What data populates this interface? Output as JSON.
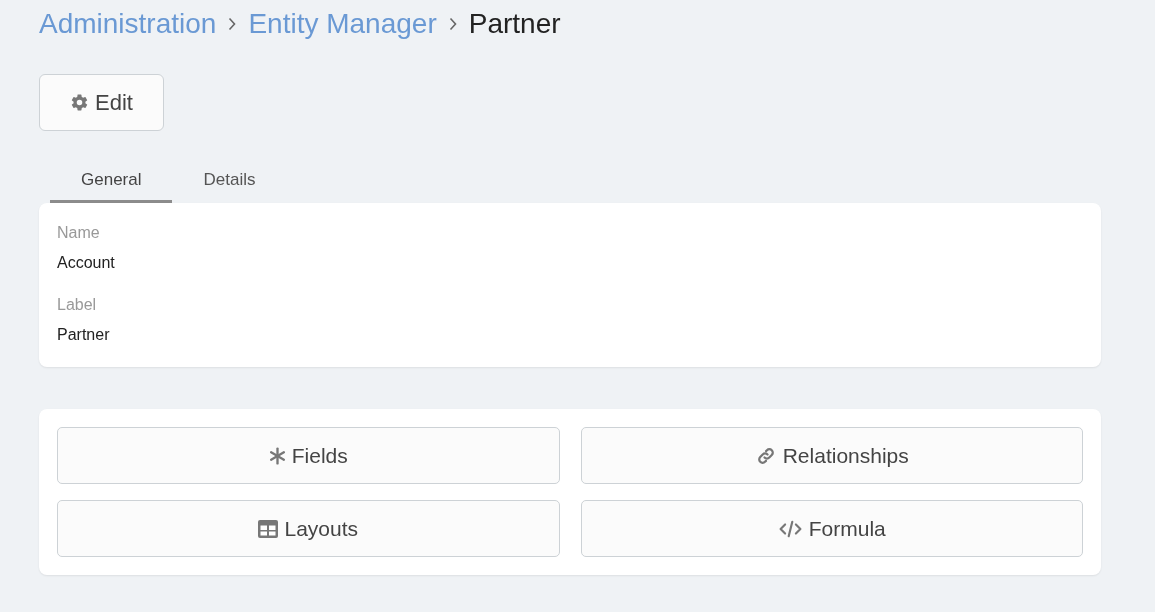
{
  "breadcrumb": [
    {
      "label": "Administration",
      "kind": "link"
    },
    {
      "label": "Entity Manager",
      "kind": "link"
    },
    {
      "label": "Partner",
      "kind": "current"
    }
  ],
  "edit_button": {
    "label": "Edit"
  },
  "tabs": [
    {
      "label": "General",
      "selected": true
    },
    {
      "label": "Details",
      "selected": false
    }
  ],
  "general": {
    "fields": [
      {
        "label": "Name",
        "value": "Account"
      },
      {
        "label": "Label",
        "value": "Partner"
      }
    ]
  },
  "actions": [
    {
      "label": "Fields"
    },
    {
      "label": "Relationships"
    },
    {
      "label": "Layouts"
    },
    {
      "label": "Formula"
    }
  ]
}
